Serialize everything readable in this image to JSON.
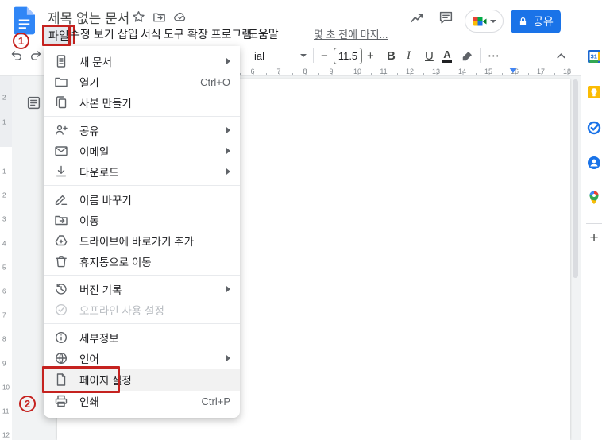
{
  "topbar": {
    "title": "제목 없는 문서",
    "menus": [
      "파일",
      "수정",
      "보기",
      "삽입",
      "서식",
      "도구",
      "확장 프로그램",
      "도움말"
    ],
    "last_edit": "몇 초 전에 마지...",
    "share_label": "공유"
  },
  "toolbar": {
    "font_partial": "ial",
    "font_size": "11.5",
    "minus": "−",
    "plus": "+",
    "bold": "B",
    "italic": "I",
    "underline": "U",
    "text_color": "A",
    "more": "⋯"
  },
  "ruler": {
    "h_numbers": [
      "6",
      "7",
      "8",
      "9",
      "10",
      "11",
      "12",
      "13",
      "14",
      "15",
      "16",
      "17",
      "18"
    ],
    "v_numbers_margin": [
      "2",
      "1"
    ],
    "v_numbers": [
      "1",
      "2",
      "3",
      "4",
      "5",
      "6",
      "7",
      "8",
      "9",
      "10",
      "11",
      "12"
    ]
  },
  "file_menu": {
    "items": [
      {
        "label": "새 문서",
        "icon": "new-document-icon",
        "submenu": true
      },
      {
        "label": "열기",
        "icon": "folder-open-icon",
        "shortcut": "Ctrl+O"
      },
      {
        "label": "사본 만들기",
        "icon": "copy-icon"
      },
      {
        "label": "공유",
        "icon": "person-add-icon",
        "submenu": true
      },
      {
        "label": "이메일",
        "icon": "email-icon",
        "submenu": true
      },
      {
        "label": "다운로드",
        "icon": "download-icon",
        "submenu": true
      },
      {
        "label": "이름 바꾸기",
        "icon": "rename-icon"
      },
      {
        "label": "이동",
        "icon": "move-folder-icon"
      },
      {
        "label": "드라이브에 바로가기 추가",
        "icon": "drive-shortcut-icon"
      },
      {
        "label": "휴지통으로 이동",
        "icon": "trash-icon"
      },
      {
        "label": "버전 기록",
        "icon": "version-history-icon",
        "submenu": true
      },
      {
        "label": "오프라인 사용 설정",
        "icon": "offline-icon",
        "disabled": true
      },
      {
        "label": "세부정보",
        "icon": "info-icon"
      },
      {
        "label": "언어",
        "icon": "globe-icon",
        "submenu": true
      },
      {
        "label": "페이지 설정",
        "icon": "page-setup-icon",
        "highlighted": true
      },
      {
        "label": "인쇄",
        "icon": "print-icon",
        "shortcut": "Ctrl+P"
      }
    ]
  },
  "annotations": {
    "step1": "1",
    "step2": "2",
    "color": "#c5221f"
  },
  "sidebar": {
    "icons": [
      "calendar",
      "keep",
      "tasks",
      "contacts",
      "maps"
    ],
    "add_label": "+"
  },
  "colors": {
    "accent": "#1a73e8",
    "annotation": "#c5221f",
    "canvas": "#f1f3f4"
  }
}
